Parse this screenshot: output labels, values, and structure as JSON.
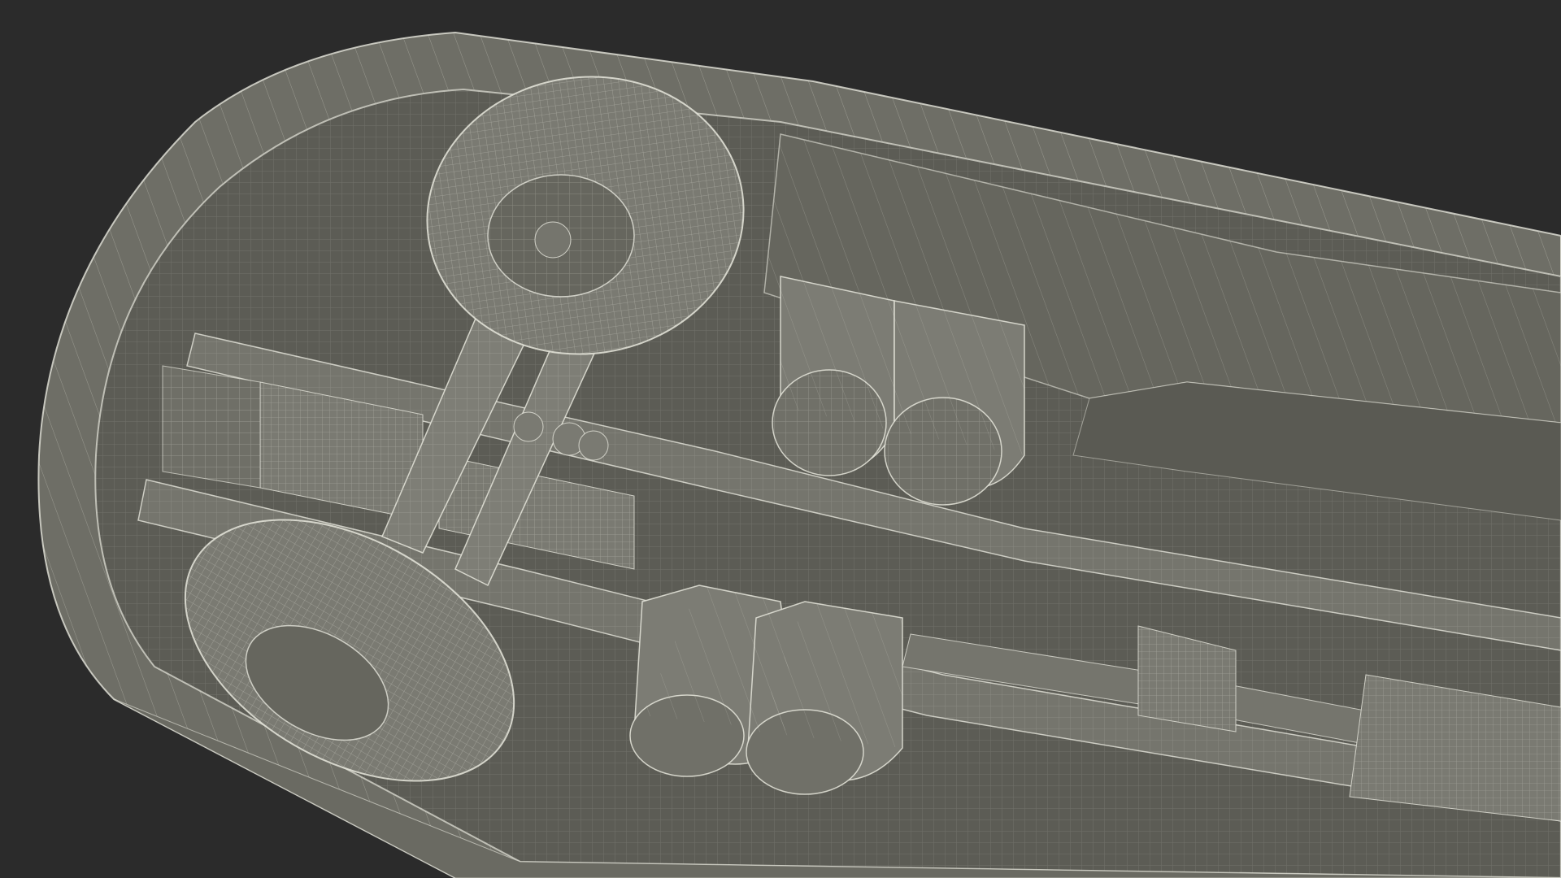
{
  "scene": {
    "background_color": "#2b2b2b",
    "surface_color": "#6b6b63",
    "surface_dark_color": "#55554d",
    "wireframe_color": "#e6e6dc"
  }
}
